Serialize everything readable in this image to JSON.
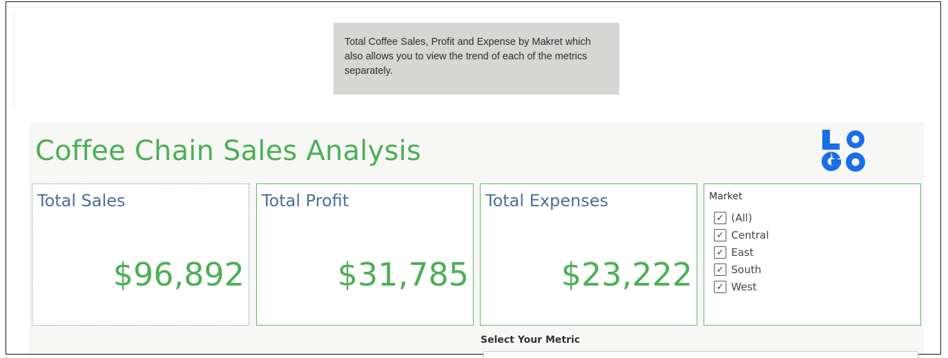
{
  "tooltip": {
    "text": "Total Coffee Sales, Profit and Expense by Makret which also allows you to view the trend of each of the metrics separately."
  },
  "dashboard": {
    "title": "Coffee Chain Sales Analysis",
    "logo": {
      "letters": "LOGO",
      "color": "#1a6ee8"
    },
    "kpis": [
      {
        "label": "Total Sales",
        "value": "$96,892"
      },
      {
        "label": "Total Profit",
        "value": "$31,785"
      },
      {
        "label": "Total Expenses",
        "value": "$23,222"
      }
    ],
    "market_filter": {
      "title": "Market",
      "options": [
        {
          "label": "(All)",
          "checked": true
        },
        {
          "label": "Central",
          "checked": true
        },
        {
          "label": "East",
          "checked": true
        },
        {
          "label": "South",
          "checked": true
        },
        {
          "label": "West",
          "checked": true
        }
      ]
    },
    "metric_selector": {
      "label": "Select Your Metric",
      "value": ""
    }
  },
  "colors": {
    "accent_green": "#4caf55",
    "label_blue": "#4a6f96",
    "tooltip_bg": "#d6d7d5"
  }
}
